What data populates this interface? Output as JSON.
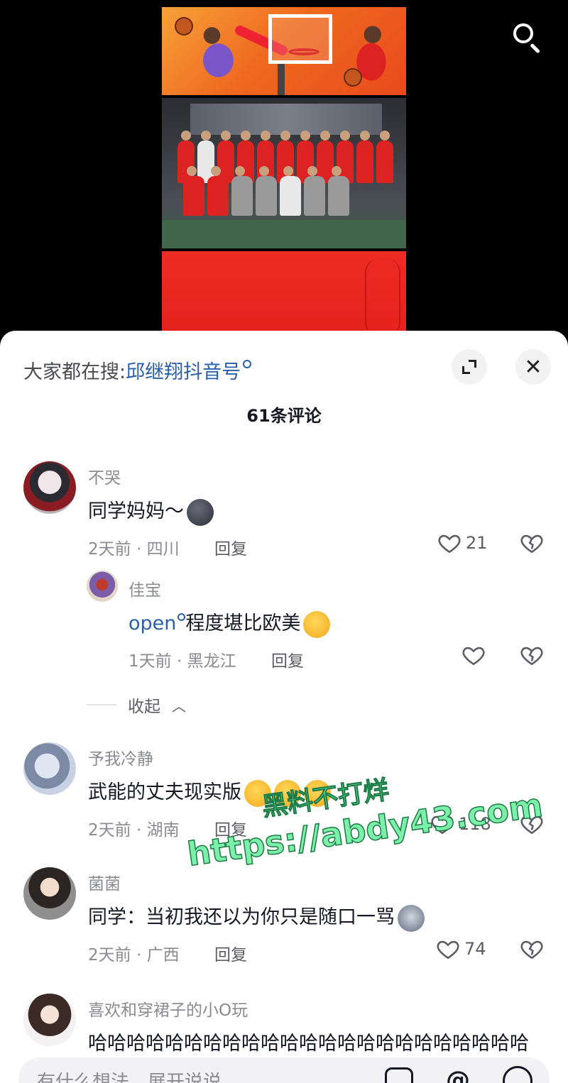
{
  "search_suggest": {
    "prefix": "大家都在搜:",
    "keyword": "邱继翔抖音号"
  },
  "comment_count_title": "61条评论",
  "icons": {
    "search": "search-icon",
    "expand": "expand-icon",
    "close": "close-icon",
    "heart": "heart-icon",
    "dislike": "broken-heart-icon",
    "collapse": "chevron-up-icon"
  },
  "comments": [
    {
      "user": "不哭",
      "text": "同学妈妈～",
      "time_location": "2天前 · 四川",
      "reply_label": "回复",
      "likes": "21"
    },
    {
      "user": "佳宝",
      "link": "open",
      "text": "程度堪比欧美",
      "time_location": "1天前 · 黑龙江",
      "reply_label": "回复",
      "likes": ""
    },
    {
      "user": "予我冷静",
      "text": "武能的丈夫现实版",
      "time_location": "2天前 · 湖南",
      "reply_label": "回复",
      "likes": "118"
    },
    {
      "user": "菌菌",
      "text": "同学：当初我还以为你只是随口一骂",
      "time_location": "2天前 · 广西",
      "reply_label": "回复",
      "likes": "74"
    },
    {
      "user": "喜欢和穿裙子的小O玩",
      "text": "哈哈哈哈哈哈哈哈哈哈哈哈哈哈哈哈哈哈哈哈哈哈哈"
    }
  ],
  "collapse_label": "收起",
  "watermark": {
    "line1": "黑料不打烊",
    "line2": "https://abdy43.com"
  },
  "input": {
    "placeholder": "有什么想法，展开说说"
  },
  "colors": {
    "link": "#2a5faa",
    "sheet_bg": "#ffffff",
    "poster_red": "#ee2a24"
  }
}
